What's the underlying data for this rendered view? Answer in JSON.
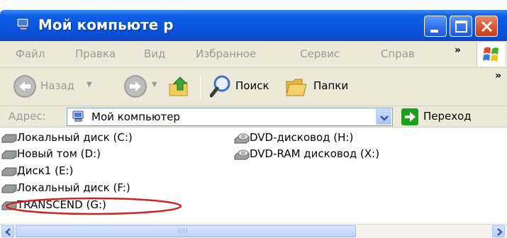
{
  "window": {
    "title": "Мой компьюте р"
  },
  "menu": {
    "items": [
      "Файл",
      "Правка",
      "Вид",
      "Избранное",
      "Сервис",
      "Справ"
    ],
    "overflow": "»"
  },
  "toolbar": {
    "back_label": "Назад",
    "search_label": "Поиск",
    "folders_label": "Папки",
    "overflow": "»"
  },
  "address": {
    "label": "Адрес:",
    "value": "Мой компьютер",
    "go_label": "Переход"
  },
  "drives": [
    {
      "label": "Локальный диск (C:)",
      "type": "hdd"
    },
    {
      "label": "Новый том (D:)",
      "type": "hdd"
    },
    {
      "label": "Диск1 (E:)",
      "type": "hdd"
    },
    {
      "label": "Локальный диск (F:)",
      "type": "hdd"
    },
    {
      "label": "TRANSCEND (G:)",
      "type": "hdd",
      "highlighted": true
    }
  ],
  "optical_drives": [
    {
      "label": "DVD-дисковод (H:)",
      "type": "dvd"
    },
    {
      "label": "DVD-RAM дисковод (X:)",
      "type": "dvd"
    }
  ],
  "scrollbar": {
    "grip": "IIII"
  },
  "colors": {
    "titlebar": "#0a58e0",
    "chrome": "#ece9d8",
    "highlight_ellipse": "#d42020",
    "go_arrow": "#1aa01a"
  }
}
